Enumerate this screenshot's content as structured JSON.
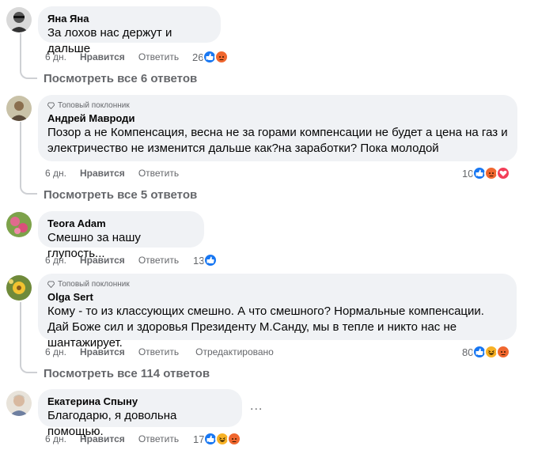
{
  "comments": [
    {
      "author": "Яна Яна",
      "text": "За лохов нас держут и дальше",
      "time": "6 дн.",
      "like_label": "Нравится",
      "reply_label": "Ответить",
      "reaction_count": "26",
      "reactions": [
        "like-icon",
        "angry-icon"
      ],
      "view_replies": "Посмотреть все 6 ответов"
    },
    {
      "badge": "Топовый поклонник",
      "author": "Андрей Мавроди",
      "text": "Позор а не Компенсация, весна не за горами компенсации не будет а цена на газ и электричество не изменится дальше как?на заработки? Пока молодой",
      "time": "6 дн.",
      "like_label": "Нравится",
      "reply_label": "Ответить",
      "reaction_count": "10",
      "reactions": [
        "like-icon",
        "angry-icon",
        "love-icon"
      ],
      "view_replies": "Посмотреть все 5 ответов"
    },
    {
      "author": "Teora Adam",
      "text": "Смешно за нашу глупость...",
      "time": "6 дн.",
      "like_label": "Нравится",
      "reply_label": "Ответить",
      "reaction_count": "13",
      "reactions": [
        "like-icon"
      ]
    },
    {
      "badge": "Топовый поклонник",
      "author": "Olga Sert",
      "text": "Кому - то из классующих смешно. А что смешного? Нормальные компенсации. Дай Боже сил и здоровья Президенту М.Санду, мы в тепле и никто нас не шантажирует.",
      "time": "6 дн.",
      "like_label": "Нравится",
      "reply_label": "Ответить",
      "edited_label": "Отредактировано",
      "reaction_count": "80",
      "reactions": [
        "like-icon",
        "haha-icon",
        "angry-icon"
      ],
      "view_replies": "Посмотреть все 114 ответов"
    },
    {
      "author": "Екатерина Спыну",
      "text": "Благодарю, я довольна помощью.",
      "time": "6 дн.",
      "like_label": "Нравится",
      "reply_label": "Ответить",
      "reaction_count": "17",
      "reactions": [
        "like-icon",
        "haha-icon",
        "angry-icon"
      ],
      "more_label": "..."
    }
  ],
  "colors": {
    "bubble": "#f0f2f5",
    "secondary_text": "#65676b",
    "like_blue": "#1877f2",
    "angry_orange": "#f0672f",
    "love_red": "#f33e58",
    "haha_yellow": "#f7b125"
  }
}
